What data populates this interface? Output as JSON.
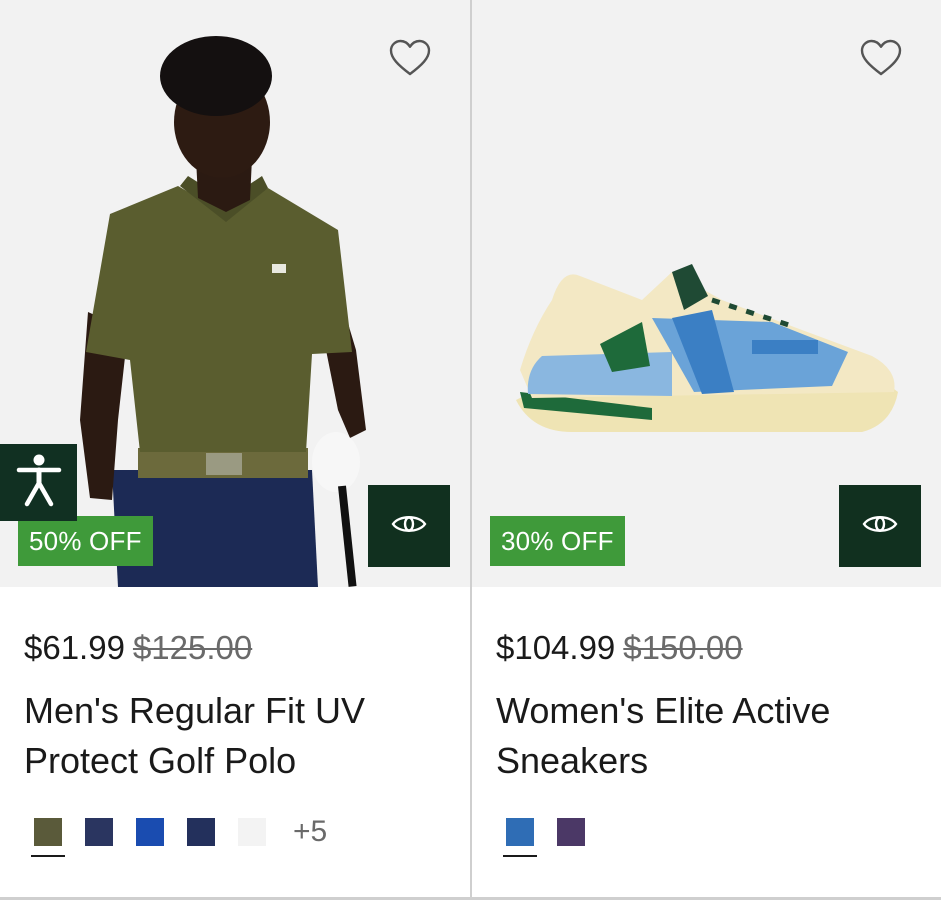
{
  "products": [
    {
      "badge": "50% OFF",
      "price": "$61.99",
      "original_price": "$125.00",
      "title": "Men's Regular Fit UV Protect Golf Polo",
      "swatches": [
        "#5a5a3a",
        "#2a3560",
        "#1a4cb0",
        "#23305c",
        "#f3f3f3"
      ],
      "more_colors": "+5",
      "selected_swatch": 0
    },
    {
      "badge": "30% OFF",
      "price": "$104.99",
      "original_price": "$150.00",
      "title": "Women's Elite Active Sneakers",
      "swatches": [
        "#2f6db5",
        "#4b3866"
      ],
      "selected_swatch": 0
    }
  ],
  "icons": {
    "wishlist": "heart-outline-icon",
    "quick_view": "eye-icon",
    "accessibility": "accessibility-person-icon"
  },
  "colors": {
    "badge_bg": "#3f9a3a",
    "dark_green": "#11301f",
    "divider": "#cfcfcf"
  }
}
